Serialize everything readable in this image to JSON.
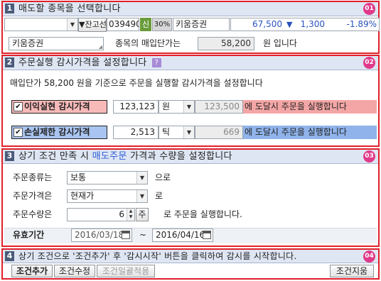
{
  "s1": {
    "num": "1",
    "title": "매도할 종목을 선택합니다",
    "badge": "01",
    "dropdown_value": "",
    "holdings_select": "▼잔고선택",
    "code": "039490",
    "credit_tag": "신",
    "margin_tag": "30%",
    "stock_name": "키움증권",
    "price": "67,500",
    "change_arrow": "▼",
    "change": "1,300",
    "rate": "-1.89%",
    "name_field": "키움증권",
    "avg_price_label": "종목의 매입단가는",
    "avg_price": "58,200",
    "avg_price_suffix": "원 입니다"
  },
  "s2": {
    "num": "2",
    "title": "주문실행 감시가격을 설정합니다",
    "help": "?",
    "badge": "02",
    "desc": "매입단가 58,200 원을 기준으로 주문을 실행할 감시가격을 설정합니다",
    "profit": {
      "check": "✔",
      "label": "이익실현 감시가격",
      "value": "123,123",
      "unit": "원",
      "computed": "123,500",
      "msg": "에 도달시 주문을 실행합니다",
      "color_bg": "#f4a6a6",
      "color_label": "#f8b9b9"
    },
    "stop": {
      "check": "✔",
      "label": "손실제한 감시가격",
      "value": "2,513",
      "unit": "틱",
      "computed": "669",
      "msg": "에 도달시 주문을 실행합니다",
      "color_bg": "#8fb3ea",
      "color_label": "#a9c4f0"
    }
  },
  "s3": {
    "num": "3",
    "title_a": "상기 조건 만족 시 ",
    "title_b": "매도주문",
    "title_c": " 가격과 수량을 설정합니다",
    "badge": "03",
    "order_type_label": "주문종류는",
    "order_type": "보통",
    "order_type_suffix": "으로",
    "order_price_label": "주문가격은",
    "order_price": "현재가",
    "order_price_suffix": "로",
    "qty_label": "주문수량은",
    "qty": "6",
    "qty_unit": "주",
    "qty_suffix": "로 주문을 실행합니다.",
    "period_label": "유효기간",
    "date_from": "2016/03/18",
    "tilde": "~",
    "date_to": "2016/04/16"
  },
  "s4": {
    "num": "4",
    "desc": "상기 조건으로 '조건추가' 후 '감시시작' 버튼을 클릭하여 감시를 시작합니다.",
    "badge": "04",
    "btn_add": "조건추가",
    "btn_edit": "조건수정",
    "btn_bulk": "조건일괄적용",
    "btn_delete": "조건지움"
  },
  "icons": {
    "calendar": "calendar-icon",
    "dropdown": "chevron-down-icon",
    "spin": "spin-arrows-icon"
  }
}
